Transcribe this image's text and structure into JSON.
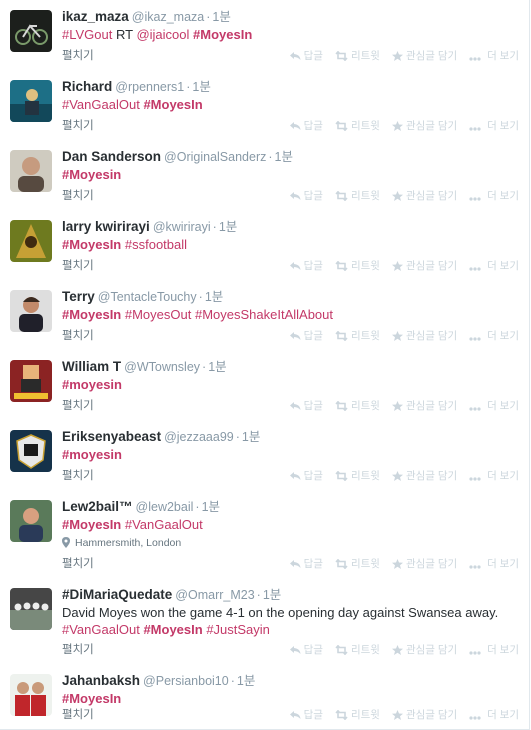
{
  "colors": {
    "hashtag": "#c33968",
    "username": "#8899a6",
    "action": "#ccd6dd",
    "border": "#e1e8ed"
  },
  "labels": {
    "expand": "펼치기",
    "reply": "답글",
    "retweet": "리트윗",
    "favorite": "관심글 담기",
    "more": "더 보기"
  },
  "tweets": [
    {
      "name": "ikaz_maza",
      "handle": "@ikaz_maza",
      "time": "1분",
      "lines": [
        [
          {
            "t": "#LVGout",
            "k": "hash"
          },
          {
            "t": " RT ",
            "k": "plain"
          },
          {
            "t": "@ijaicool",
            "k": "mention"
          },
          {
            "t": " ",
            "k": "plain"
          },
          {
            "t": "#MoyesIn",
            "k": "hash strong"
          }
        ]
      ],
      "location": "",
      "avatar_icon": "bicycle-avatar"
    },
    {
      "name": "Richard",
      "handle": "@rpenners1",
      "time": "1분",
      "lines": [
        [
          {
            "t": "#VanGaalOut",
            "k": "hash"
          },
          {
            "t": " ",
            "k": "plain"
          },
          {
            "t": "#MoyesIn",
            "k": "hash strong"
          }
        ]
      ],
      "location": "",
      "avatar_icon": "diver-avatar"
    },
    {
      "name": "Dan Sanderson",
      "handle": "@OriginalSanderz",
      "time": "1분",
      "lines": [
        [
          {
            "t": "#Moyesin",
            "k": "hash strong"
          }
        ]
      ],
      "location": "",
      "avatar_icon": "portrait-avatar"
    },
    {
      "name": "larry kwirirayi",
      "handle": "@kwirirayi",
      "time": "1분",
      "lines": [
        [
          {
            "t": "#MoyesIn",
            "k": "hash strong"
          },
          {
            "t": " ",
            "k": "plain"
          },
          {
            "t": "#ssfootball",
            "k": "hash"
          }
        ]
      ],
      "location": "",
      "avatar_icon": "tree-avatar"
    },
    {
      "name": "Terry",
      "handle": "@TentacleTouchy",
      "time": "1분",
      "lines": [
        [
          {
            "t": "#MoyesIn",
            "k": "hash strong"
          },
          {
            "t": " ",
            "k": "plain"
          },
          {
            "t": "#MoyesOut",
            "k": "hash"
          },
          {
            "t": " ",
            "k": "plain"
          },
          {
            "t": "#MoyesShakeItAllAbout",
            "k": "hash"
          }
        ]
      ],
      "location": "",
      "avatar_icon": "person-avatar"
    },
    {
      "name": "William T",
      "handle": "@WTownsley",
      "time": "1분",
      "lines": [
        [
          {
            "t": "#moyesin",
            "k": "hash strong"
          }
        ]
      ],
      "location": "",
      "avatar_icon": "pixel-character-avatar"
    },
    {
      "name": "Eriksenyabeast",
      "handle": "@jezzaaa99",
      "time": "1분",
      "lines": [
        [
          {
            "t": "#moyesin",
            "k": "hash strong"
          }
        ]
      ],
      "location": "",
      "avatar_icon": "club-crest-avatar"
    },
    {
      "name": "Lew2bail™",
      "handle": "@lew2bail",
      "time": "1분",
      "lines": [
        [
          {
            "t": "#MoyesIn",
            "k": "hash strong"
          },
          {
            "t": " ",
            "k": "plain"
          },
          {
            "t": "#VanGaalOut",
            "k": "hash"
          }
        ]
      ],
      "location": "Hammersmith, London",
      "avatar_icon": "man-avatar"
    },
    {
      "name": "#DiMariaQuedate",
      "handle": "@Omarr_M23",
      "time": "1분",
      "lines": [
        [
          {
            "t": "David Moyes won the game 4-1 on the opening day against Swansea away.",
            "k": "plain"
          }
        ],
        [
          {
            "t": "#VanGaalOut",
            "k": "hash"
          },
          {
            "t": " ",
            "k": "plain"
          },
          {
            "t": "#MoyesIn",
            "k": "hash strong"
          },
          {
            "t": " ",
            "k": "plain"
          },
          {
            "t": "#JustSayin",
            "k": "hash"
          }
        ]
      ],
      "location": "",
      "avatar_icon": "team-photo-avatar"
    },
    {
      "name": "Jahanbaksh",
      "handle": "@Persianboi10",
      "time": "1분",
      "lines": [
        [
          {
            "t": "#MoyesIn",
            "k": "hash strong"
          }
        ]
      ],
      "location": "",
      "avatar_icon": "players-avatar"
    }
  ]
}
